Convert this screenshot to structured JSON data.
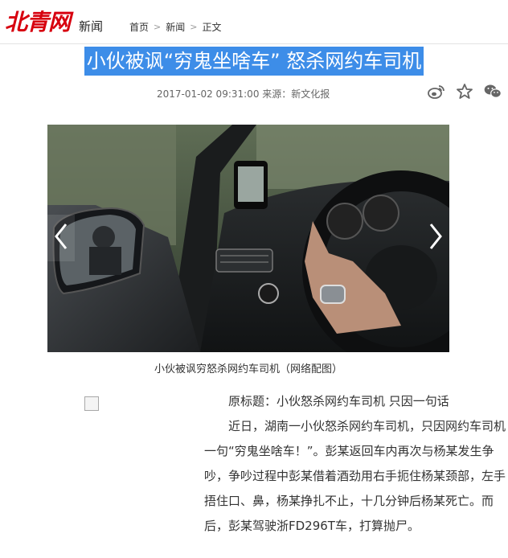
{
  "header": {
    "logo_text": "北青网",
    "section": "新闻",
    "breadcrumb": [
      "首页",
      "新闻",
      "正文"
    ],
    "breadcrumb_sep": ">"
  },
  "article": {
    "title": "小伙被讽“穷鬼坐啥车” 怒杀网约车司机",
    "meta": "2017-01-02 09:31:00 来源：新文化报",
    "share_icons": [
      "weibo-icon",
      "star-icon",
      "wechat-icon"
    ],
    "image_caption": "小伙被讽穷怒杀网约车司机（网络配图）",
    "paragraphs": [
      "原标题：小伙怒杀网约车司机 只因一句话",
      "近日，湖南一小伙怒杀网约车司机，只因网约车司机一句“穷鬼坐啥车！”。彭某返回车内再次与杨某发生争吵，争吵过程中彭某借着酒劲用右手扼住杨某颈部，左手捂住口、鼻，杨某挣扎不止，十几分钟后杨某死亡。而后，彭某驾驶浙FD296T车，打算抛尸。"
    ]
  },
  "colors": {
    "brand": "#d7000f",
    "title_highlight": "#3d8de8"
  }
}
